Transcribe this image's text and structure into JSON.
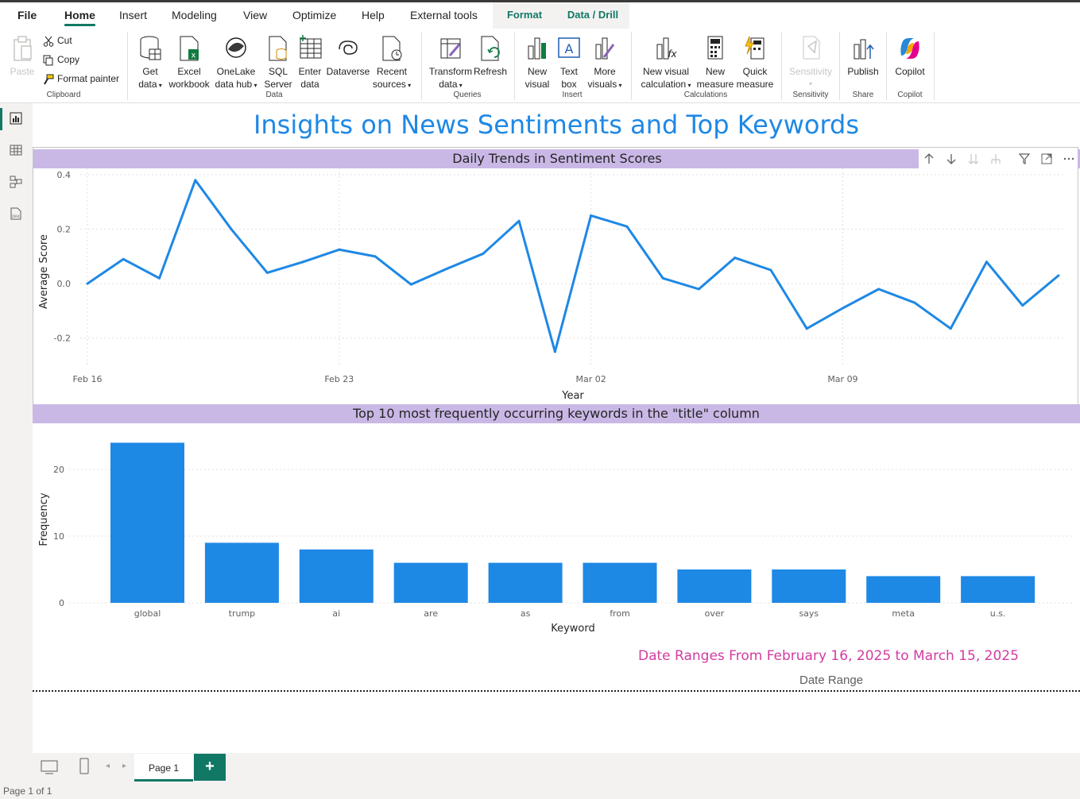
{
  "tabs": [
    "File",
    "Home",
    "Insert",
    "Modeling",
    "View",
    "Optimize",
    "Help",
    "External tools",
    "Format",
    "Data / Drill"
  ],
  "ribbon": {
    "clipboard": {
      "paste": "Paste",
      "cut": "Cut",
      "copy": "Copy",
      "format_painter": "Format painter",
      "label": "Clipboard"
    },
    "data": {
      "get_data": [
        "Get",
        "data"
      ],
      "excel": [
        "Excel",
        "workbook"
      ],
      "onelake": [
        "OneLake",
        "data hub"
      ],
      "sql": [
        "SQL",
        "Server"
      ],
      "enter": [
        "Enter",
        "data"
      ],
      "dataverse": "Dataverse",
      "recent": [
        "Recent",
        "sources"
      ],
      "label": "Data"
    },
    "queries": {
      "transform": [
        "Transform",
        "data"
      ],
      "refresh": "Refresh",
      "label": "Queries"
    },
    "insert": {
      "new_visual": [
        "New",
        "visual"
      ],
      "text_box": [
        "Text",
        "box"
      ],
      "more_visuals": [
        "More",
        "visuals"
      ],
      "label": "Insert"
    },
    "calculations": {
      "new_visual_calc": [
        "New visual",
        "calculation"
      ],
      "new_measure": [
        "New",
        "measure"
      ],
      "quick_measure": [
        "Quick",
        "measure"
      ],
      "label": "Calculations"
    },
    "sensitivity": {
      "button": "Sensitivity",
      "label": "Sensitivity"
    },
    "share": {
      "publish": "Publish",
      "label": "Share"
    },
    "copilot": {
      "button": "Copilot",
      "label": "Copilot"
    }
  },
  "report": {
    "title": "Insights on News Sentiments and Top Keywords",
    "date_range_text": "Date Ranges From February 16, 2025 to March 15, 2025",
    "date_range_label": "Date Range"
  },
  "colors": {
    "accent": "#117865",
    "series": "#1e88e5",
    "header_bg": "#c9b8e6",
    "date_text": "#d23ca0"
  },
  "chart_data": [
    {
      "type": "line",
      "title": "Daily Trends in Sentiment Scores",
      "xlabel": "Year",
      "ylabel": "Average Score",
      "x_ticks": [
        "Feb 16",
        "Feb 23",
        "Mar 02",
        "Mar 09"
      ],
      "y_ticks": [
        "0.4",
        "0.2",
        "0.0",
        "-0.2"
      ],
      "ylim": [
        -0.3,
        0.4
      ],
      "x": [
        "2025-02-16",
        "2025-02-17",
        "2025-02-18",
        "2025-02-19",
        "2025-02-20",
        "2025-02-21",
        "2025-02-22",
        "2025-02-23",
        "2025-02-24",
        "2025-02-25",
        "2025-02-26",
        "2025-02-27",
        "2025-02-28",
        "2025-03-01",
        "2025-03-02",
        "2025-03-03",
        "2025-03-04",
        "2025-03-05",
        "2025-03-06",
        "2025-03-07",
        "2025-03-08",
        "2025-03-09",
        "2025-03-10",
        "2025-03-11",
        "2025-03-12",
        "2025-03-13",
        "2025-03-14",
        "2025-03-15"
      ],
      "values": [
        0.0,
        0.09,
        0.02,
        0.38,
        0.2,
        0.04,
        0.08,
        0.125,
        0.1,
        -0.003,
        0.055,
        0.11,
        0.23,
        -0.25,
        0.25,
        0.21,
        0.02,
        -0.02,
        0.095,
        0.05,
        -0.165,
        -0.09,
        -0.02,
        -0.07,
        -0.165,
        0.08,
        -0.08,
        0.03
      ],
      "grid": true
    },
    {
      "type": "bar",
      "title": "Top 10 most frequently occurring keywords in the \"title\" column",
      "xlabel": "Keyword",
      "ylabel": "Frequency",
      "categories": [
        "global",
        "trump",
        "ai",
        "are",
        "as",
        "from",
        "over",
        "says",
        "meta",
        "u.s."
      ],
      "values": [
        24,
        9,
        8,
        6,
        6,
        6,
        5,
        5,
        4,
        4
      ],
      "y_ticks": [
        "0",
        "10",
        "20"
      ],
      "ylim": [
        0,
        25
      ],
      "grid": true
    }
  ],
  "pages": {
    "current": "Page 1",
    "status": "Page 1 of 1",
    "add": "+"
  }
}
